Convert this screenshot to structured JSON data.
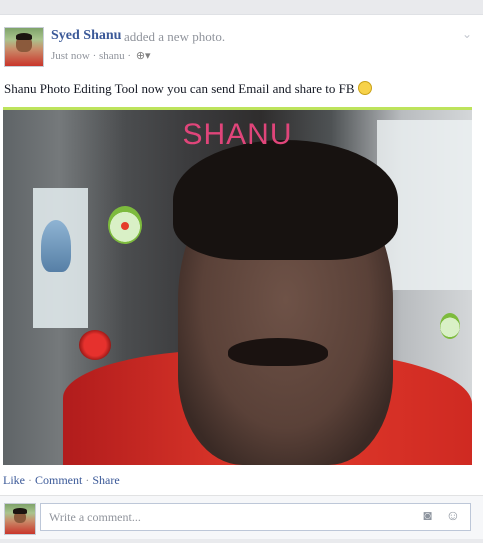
{
  "post": {
    "author": "Syed Shanu",
    "action": "added a new photo.",
    "time": "Just now",
    "separator": "·",
    "location": "shanu",
    "privacy_icon": "globe-icon",
    "status_text": "Shanu Photo Editing Tool now you can send Email and share to FB",
    "photo_watermark": "SHANU",
    "actions": {
      "like": "Like",
      "comment": "Comment",
      "share": "Share"
    },
    "comment_placeholder": "Write a comment..."
  },
  "colors": {
    "link": "#3b5998",
    "meta": "#90949c",
    "photo_border": "#bde35c",
    "watermark": "#e0457a"
  }
}
